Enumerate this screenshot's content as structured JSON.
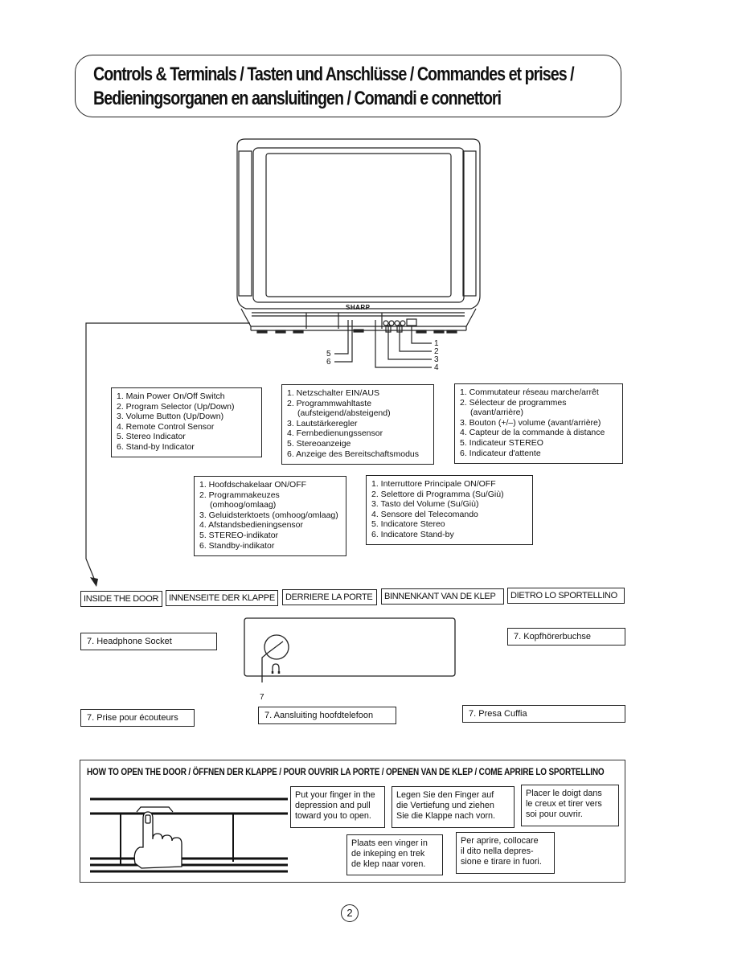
{
  "header": {
    "title_line1": "Controls & Terminals / Tasten und Anschlüsse / Commandes et prises /",
    "title_line2": "Bedieningsorganen en aansluitingen / Comandi e connettori"
  },
  "tv": {
    "brand": "SHARP",
    "callouts": [
      "1",
      "2",
      "3",
      "4",
      "5",
      "6"
    ]
  },
  "legends": {
    "en": [
      "1. Main Power On/Off Switch",
      "2. Program Selector (Up/Down)",
      "3. Volume Button (Up/Down)",
      "4. Remote Control Sensor",
      "5. Stereo Indicator",
      "6. Stand-by Indicator"
    ],
    "de": [
      "1. Netzschalter EIN/AUS",
      "2. Programmwahltaste",
      "(aufsteigend/absteigend)",
      "3. Lautstärkeregler",
      "4. Fernbedienungssensor",
      "5. Stereoanzeige",
      "6. Anzeige des Bereitschaftsmodus"
    ],
    "fr": [
      "1. Commutateur réseau marche/arrêt",
      "2. Sélecteur de programmes",
      "(avant/arrière)",
      "3. Bouton (+/–) volume (avant/arrière)",
      "4. Capteur de la commande à distance",
      "5. Indicateur STEREO",
      "6. Indicateur d'attente"
    ],
    "nl": [
      "1. Hoofdschakelaar ON/OFF",
      "2. Programmakeuzes",
      "(omhoog/omlaag)",
      "3. Geluidsterktoets (omhoog/omlaag)",
      "4. Afstandsbedieningsensor",
      "5. STEREO-indikator",
      "6. Standby-indikator"
    ],
    "it": [
      "1. Interruttore Principale ON/OFF",
      "2. Selettore di Programma (Su/Giù)",
      "3. Tasto del Volume (Su/Giù)",
      "4. Sensore del Telecomando",
      "5. Indicatore Stereo",
      "6. Indicatore Stand-by"
    ]
  },
  "door_tags": [
    "INSIDE THE DOOR",
    "INNENSEITE DER KLAPPE",
    "DERRIERE LA PORTE",
    "BINNENKANT VAN DE KLEP",
    "DIETRO LO SPORTELLINO"
  ],
  "headphone": {
    "callout": "7",
    "labels": {
      "en": "7. Headphone Socket",
      "de": "7. Kopfhörerbuchse",
      "fr": "7. Prise pour écouteurs",
      "nl": "7. Aansluiting hoofdtelefoon",
      "it": "7. Presa Cuffia"
    }
  },
  "howto": {
    "title": "HOW TO OPEN THE DOOR / ÖFFNEN DER KLAPPE / POUR OUVRIR LA PORTE / OPENEN VAN DE KLEP / COME APRIRE LO SPORTELLINO",
    "en": [
      "Put your finger in the",
      "depression and pull",
      "toward you to open."
    ],
    "de": [
      "Legen Sie den Finger auf",
      "die Vertiefung und ziehen",
      "Sie die Klappe nach vorn."
    ],
    "fr": [
      "Placer le doigt dans",
      "le creux et tirer vers",
      "soi pour ouvrir."
    ],
    "nl": [
      "Plaats een vinger in",
      "de inkeping en trek",
      "de klep naar voren."
    ],
    "it": [
      "Per aprire, collocare",
      "il dito nella depres-",
      "sione e tirare in fuori."
    ]
  },
  "page_number": "2"
}
